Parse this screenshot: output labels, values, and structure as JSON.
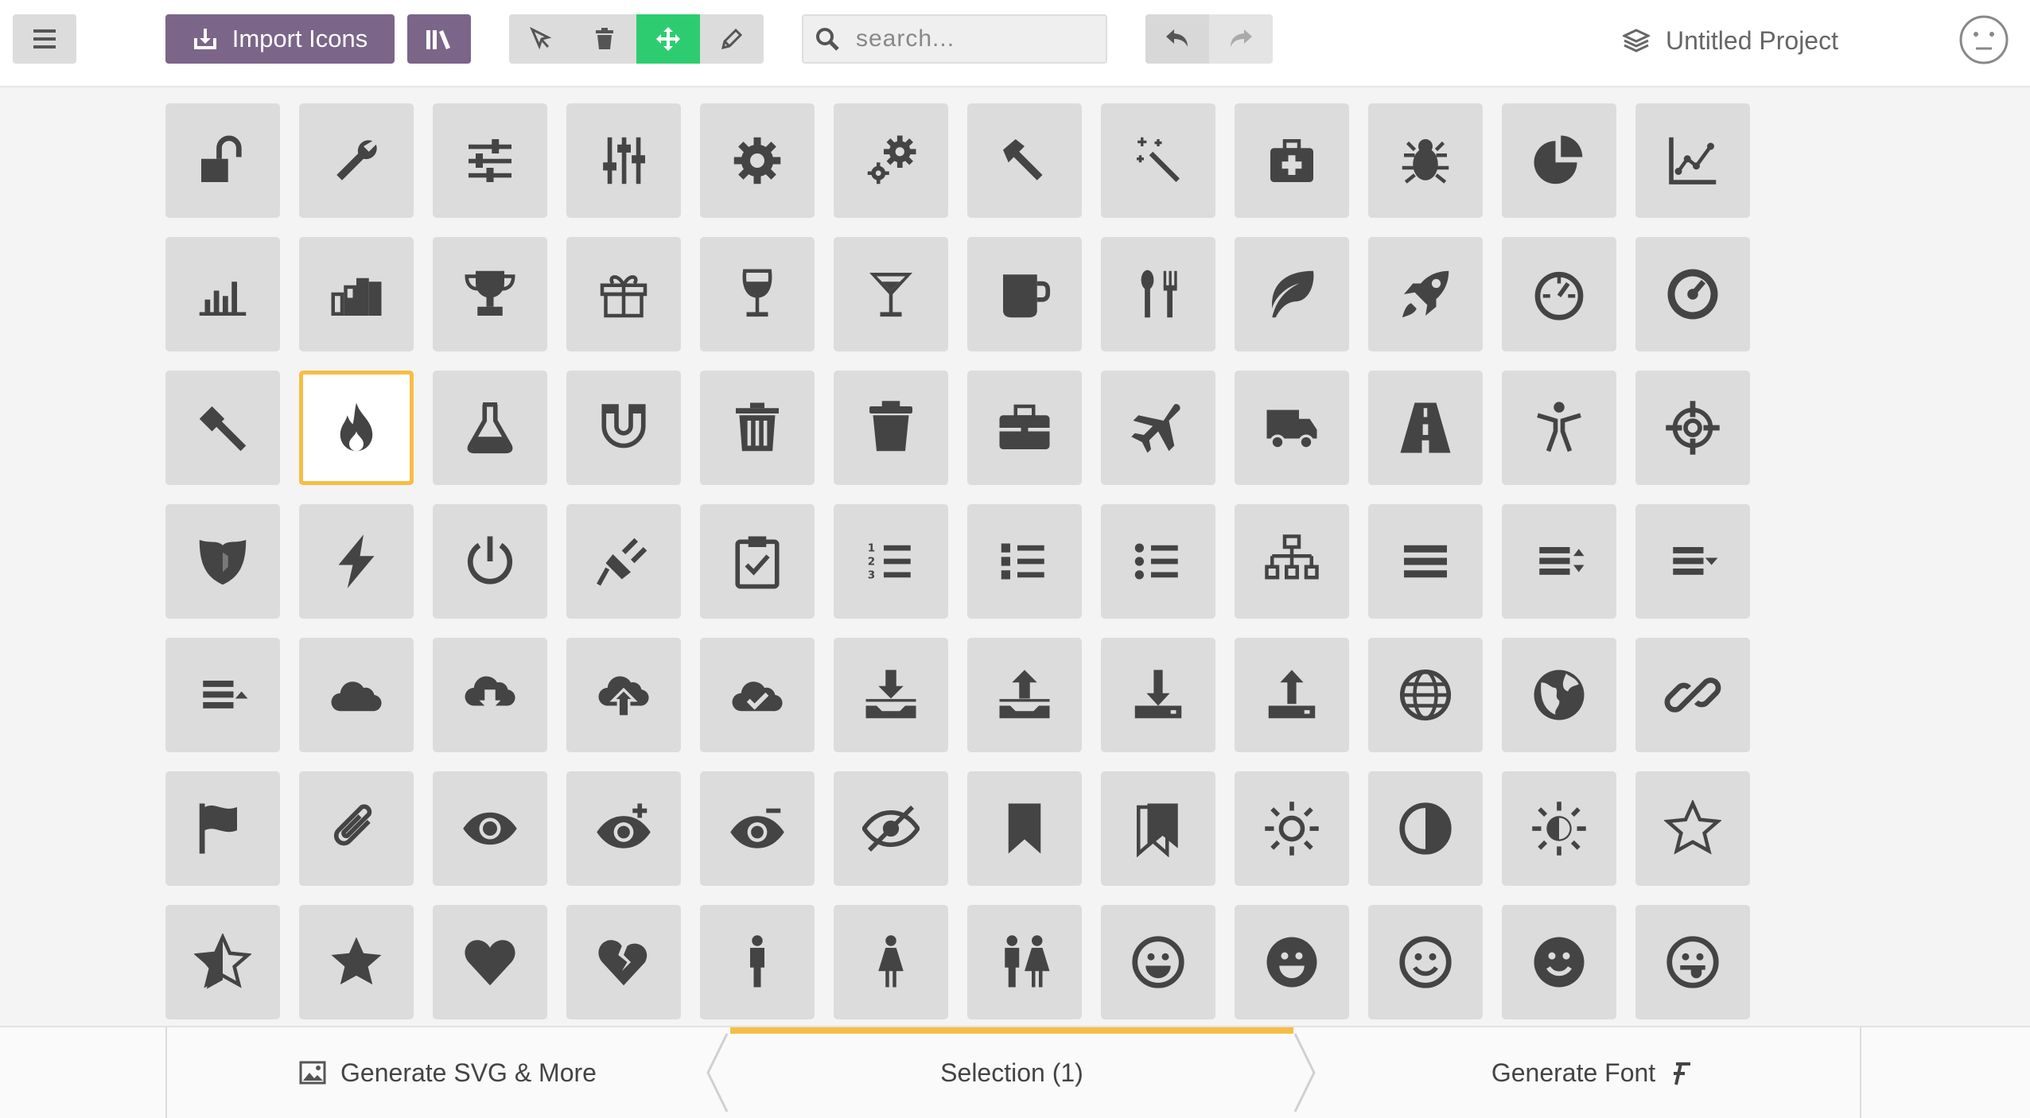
{
  "toolbar": {
    "import_label": "Import Icons",
    "search_placeholder": "search...",
    "project_name": "Untitled Project"
  },
  "colors": {
    "accent_purple": "#7b6589",
    "active_green": "#2ecc71",
    "selection_orange": "#f6bd45",
    "tile_gray": "#dcdcdc",
    "icon_dark": "#444444"
  },
  "icons": [
    "unlocked-icon",
    "wrench-icon",
    "equalizer-icon",
    "equalizer-vertical-icon",
    "cog-icon",
    "cogs-icon",
    "hammer-icon",
    "magic-wand-icon",
    "aid-kit-icon",
    "bug-icon",
    "pie-chart-icon",
    "stats-dots-icon",
    "stats-bars-icon",
    "stats-bars2-icon",
    "trophy-icon",
    "gift-icon",
    "glass-icon",
    "glass2-icon",
    "mug-icon",
    "spoon-knife-icon",
    "leaf-icon",
    "rocket-icon",
    "meter-icon",
    "meter2-icon",
    "hammer2-icon",
    "fire-icon",
    "lab-icon",
    "magnet-icon",
    "bin-icon",
    "bin2-icon",
    "briefcase-icon",
    "airplane-icon",
    "truck-icon",
    "road-icon",
    "accessibility-icon",
    "target-icon",
    "shield-icon",
    "power-icon",
    "switch-icon",
    "power-cord-icon",
    "clipboard-icon",
    "list-numbered-icon",
    "list-icon",
    "list2-icon",
    "tree-icon",
    "menu-icon",
    "menu2-icon",
    "menu3-icon",
    "menu4-icon",
    "cloud-icon",
    "cloud-download-icon",
    "cloud-upload-icon",
    "cloud-check-icon",
    "download2-icon",
    "upload2-icon",
    "download3-icon",
    "upload3-icon",
    "sphere-icon",
    "earth-icon",
    "link-icon",
    "flag-icon",
    "attachment-icon",
    "eye-icon",
    "eye-plus-icon",
    "eye-minus-icon",
    "eye-blocked-icon",
    "bookmark-icon",
    "bookmarks-icon",
    "contrast-sun-icon",
    "contrast-icon",
    "brightness-icon",
    "star-empty-icon",
    "star-half-icon",
    "star-full-icon",
    "heart-icon",
    "heart-broken-icon",
    "man-icon",
    "woman-icon",
    "man-woman-icon",
    "happy-icon",
    "happy2-icon",
    "smile-icon",
    "smile2-icon",
    "tongue-icon"
  ],
  "selected_icon": "fire-icon",
  "bottombar": {
    "generate_svg_label": "Generate SVG & More",
    "selection_label": "Selection (1)",
    "generate_font_label": "Generate Font"
  }
}
